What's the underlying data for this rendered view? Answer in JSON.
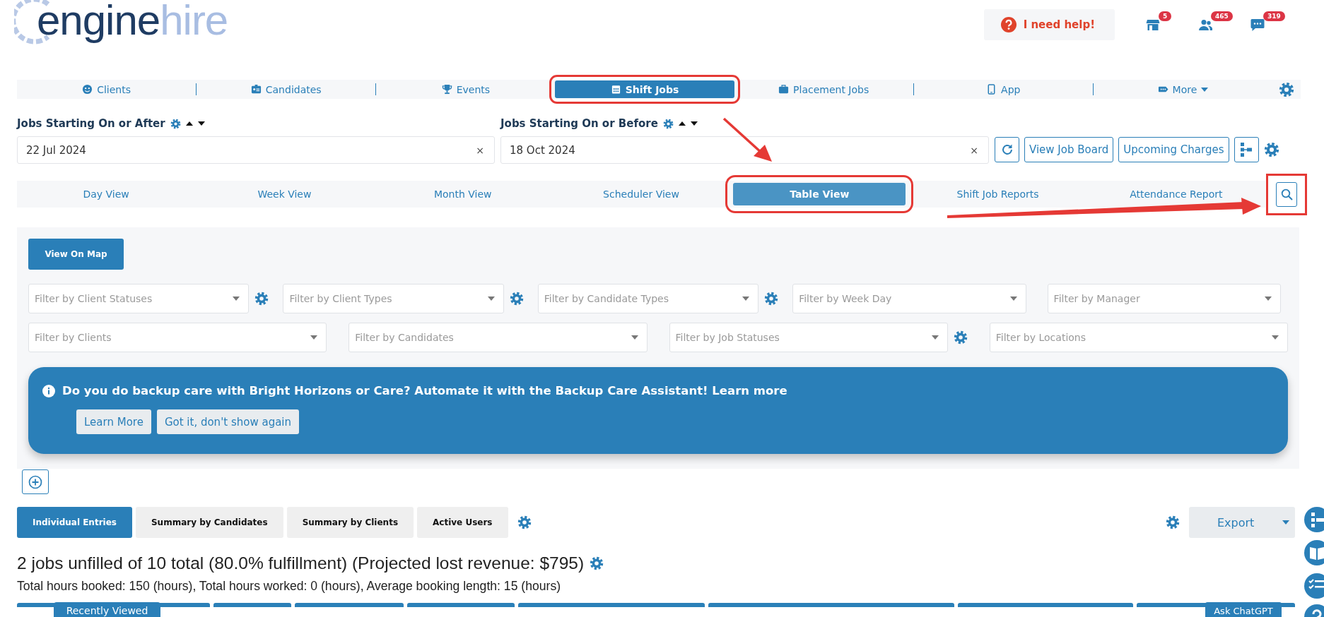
{
  "logo": {
    "text_main": "engine",
    "text_accent": "hire"
  },
  "help_button": {
    "label": "I need help!"
  },
  "notifications": [
    {
      "kind": "store",
      "count": "5"
    },
    {
      "kind": "people",
      "count": "465"
    },
    {
      "kind": "chat",
      "count": "319"
    }
  ],
  "main_nav": [
    {
      "kind": "clients",
      "label": "Clients",
      "selected": false,
      "annotated": false
    },
    {
      "kind": "candidates",
      "label": "Candidates",
      "selected": false,
      "annotated": false
    },
    {
      "kind": "events",
      "label": "Events",
      "selected": false,
      "annotated": false
    },
    {
      "kind": "shift",
      "label": "Shift Jobs",
      "selected": true,
      "annotated": true
    },
    {
      "kind": "placement",
      "label": "Placement Jobs",
      "selected": false,
      "annotated": false
    },
    {
      "kind": "app",
      "label": "App",
      "selected": false,
      "annotated": false
    },
    {
      "kind": "more",
      "label": "More",
      "selected": false,
      "annotated": false
    }
  ],
  "date_filters": [
    {
      "label": "Jobs Starting On or After",
      "value": "22 Jul 2024"
    },
    {
      "label": "Jobs Starting On or Before",
      "value": "18 Oct 2024"
    }
  ],
  "clear_mark": "×",
  "action_buttons": [
    "View Job Board",
    "Upcoming Charges"
  ],
  "view_tabs": [
    {
      "label": "Day View",
      "selected": false,
      "annotated": false
    },
    {
      "label": "Week View",
      "selected": false,
      "annotated": false
    },
    {
      "label": "Month View",
      "selected": false,
      "annotated": false
    },
    {
      "label": "Scheduler View",
      "selected": false,
      "annotated": false
    },
    {
      "label": "Table View",
      "selected": true,
      "annotated": true
    },
    {
      "label": "Shift Job Reports",
      "selected": false,
      "annotated": false
    },
    {
      "label": "Attendance Report",
      "selected": false,
      "annotated": false
    }
  ],
  "search_button": {
    "annotated": true
  },
  "filters": {
    "map_button": "View On Map",
    "rows": [
      [
        {
          "placeholder": "Filter by Client Statuses",
          "settings": true
        },
        {
          "placeholder": "Filter by Client Types",
          "settings": true
        },
        {
          "placeholder": "Filter by Candidate Types",
          "settings": true
        },
        {
          "placeholder": "Filter by Week Day",
          "settings": false
        },
        {
          "placeholder": "Filter by Manager",
          "settings": false
        }
      ],
      [
        {
          "placeholder": "Filter by Clients",
          "settings": false
        },
        {
          "placeholder": "Filter by Candidates",
          "settings": false
        },
        {
          "placeholder": "Filter by Job Statuses",
          "settings": true
        },
        {
          "placeholder": "Filter by Locations",
          "settings": false
        }
      ]
    ]
  },
  "banner": {
    "text": "Do you do backup care with Bright Horizons or Care? Automate it with the Backup Care Assistant! Learn more",
    "buttons": [
      "Learn More",
      "Got it, don't show again"
    ]
  },
  "report_tabs": [
    {
      "label": "Individual Entries",
      "selected": true
    },
    {
      "label": "Summary by Candidates",
      "selected": false
    },
    {
      "label": "Summary by Clients",
      "selected": false
    },
    {
      "label": "Active Users",
      "selected": false
    }
  ],
  "export_button": "Export",
  "summary": "2 jobs unfilled of 10 total (80.0% fulfillment) (Projected lost revenue: $795)",
  "hours": "Total hours booked: 150 (hours), Total hours worked: 0 (hours), Average booking length: 15 (hours)",
  "recently_viewed": "Recently Viewed",
  "ask_chatgpt": "Ask ChatGPT"
}
